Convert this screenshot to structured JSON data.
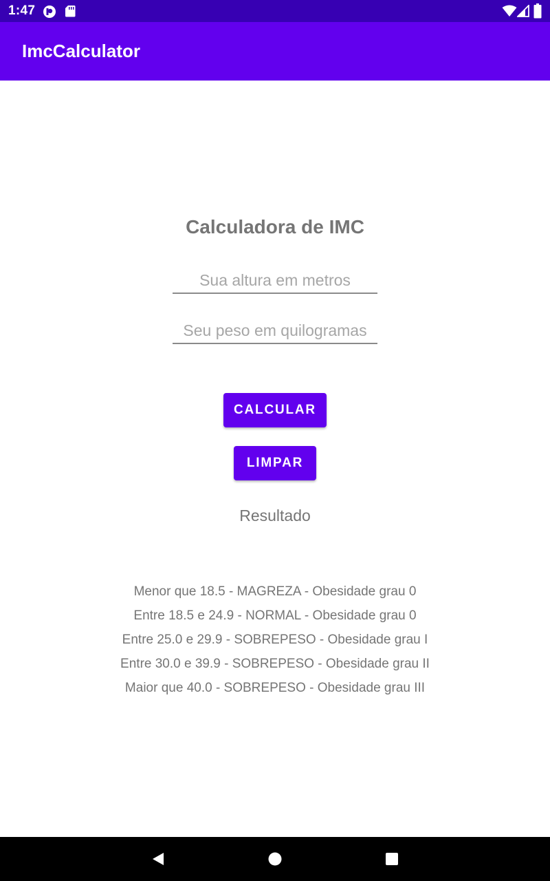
{
  "status_bar": {
    "time": "1:47",
    "colors": {
      "background": "#3700b3",
      "icons": "#ffffff"
    },
    "left_icons": [
      "notification-app-icon",
      "sd-card-icon"
    ],
    "right_icons": [
      "wifi-icon",
      "signal-icon",
      "battery-icon"
    ]
  },
  "app_bar": {
    "title": "ImcCalculator",
    "color": "#6200ee"
  },
  "form": {
    "heading": "Calculadora de IMC",
    "height_input": {
      "placeholder": "Sua altura em metros",
      "value": ""
    },
    "weight_input": {
      "placeholder": "Seu peso em quilogramas",
      "value": ""
    },
    "calculate_label": "CALCULAR",
    "clear_label": "LIMPAR",
    "button_color": "#6200ee"
  },
  "result": {
    "label": "Resultado"
  },
  "legend": [
    "Menor que 18.5 - MAGREZA - Obesidade grau 0",
    "Entre 18.5 e 24.9 - NORMAL - Obesidade grau 0",
    "Entre 25.0 e 29.9 - SOBREPESO - Obesidade grau I",
    "Entre 30.0 e 39.9 - SOBREPESO - Obesidade grau II",
    "Maior que 40.0 - SOBREPESO - Obesidade grau III"
  ],
  "nav_bar": {
    "buttons": [
      "back-icon",
      "home-icon",
      "recents-icon"
    ]
  }
}
